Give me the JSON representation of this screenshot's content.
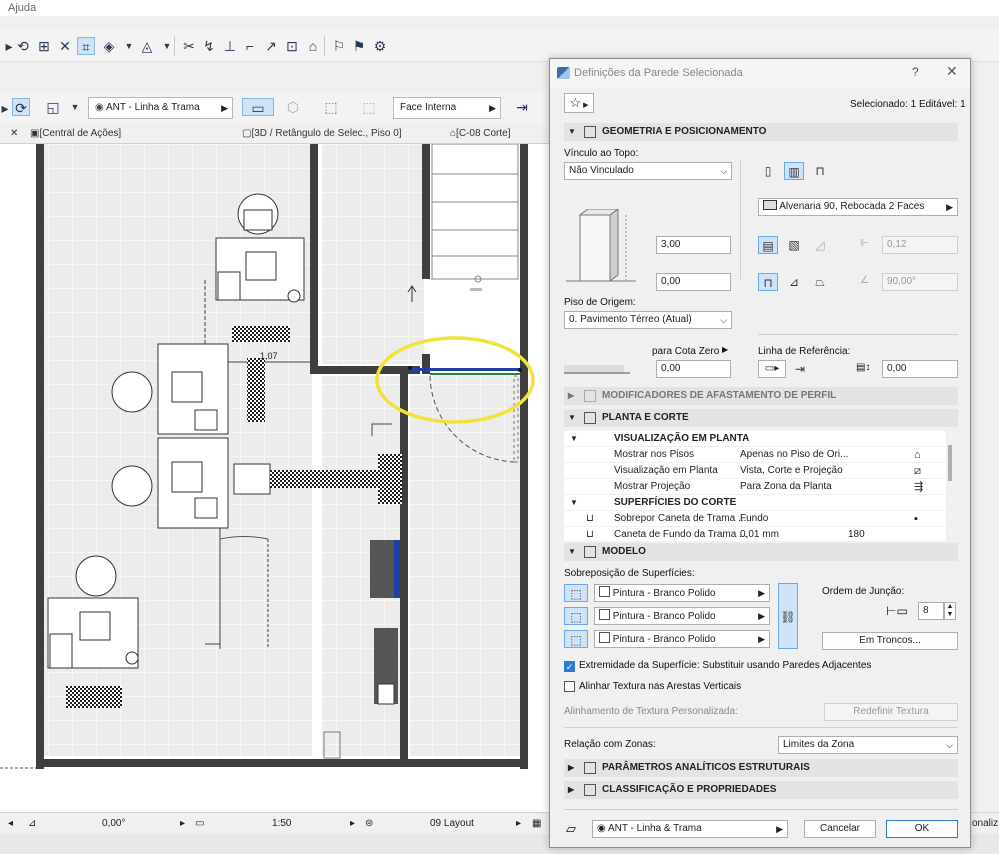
{
  "menu": {
    "help": "Ajuda"
  },
  "toolbar2": {
    "layer": "ANT - Linha & Trama",
    "surface": "Face Interna"
  },
  "tabs": [
    "[Central de Ações]",
    "[3D / Retângulo de Selec., Piso 0]",
    "[C-08 Corte]"
  ],
  "plan": {
    "dimension": "1,07"
  },
  "statusbar": {
    "angle": "0,00°",
    "scale": "1:50",
    "layout": "09 Layout",
    "edge_text": "onaliz"
  },
  "dialog": {
    "title": "Definições da Parede Selecionada",
    "help": "?",
    "close": "✕",
    "selected": "Selecionado: 1 Editável: 1",
    "sections": {
      "geometry": "GEOMETRIA E POSICIONAMENTO",
      "profile": "MODIFICADORES DE AFASTAMENTO DE PERFIL",
      "plan_section": "PLANTA E CORTE",
      "model": "MODELO",
      "structural": "PARÂMETROS ANALÍTICOS ESTRUTURAIS",
      "classification": "CLASSIFICAÇÃO E PROPRIEDADES"
    },
    "geometry": {
      "top_link_label": "Vínculo ao Topo:",
      "top_link_value": "Não Vinculado",
      "composite": "Alvenaria 90, Rebocada 2 Faces",
      "height": "3,00",
      "thickness": "0,12",
      "offset": "0,00",
      "angle": "90,00°",
      "home_story_label": "Piso de Origem:",
      "home_story_value": "0. Pavimento Térreo (Atual)",
      "to_project_zero": "para Cota Zero",
      "base_offset": "0,00",
      "ref_line_label": "Linha de Referência:",
      "ref_line_offset": "0,00"
    },
    "plan_tree": {
      "header1": "VISUALIZAÇÃO EM PLANTA",
      "rows": [
        {
          "name": "Mostrar nos Pisos",
          "value": "Apenas no Piso de Ori..."
        },
        {
          "name": "Visualização em Planta",
          "value": "Vista, Corte e Projeção"
        },
        {
          "name": "Mostrar Projeção",
          "value": "Para Zona da Planta"
        }
      ],
      "header2": "SUPERFÍCIES DO CORTE",
      "rows2": [
        {
          "name": "Sobrepor Caneta de Trama ...",
          "value": "Fundo"
        },
        {
          "name": "Caneta de Fundo da Trama ...",
          "value": "0,01 mm",
          "extra": "180"
        }
      ]
    },
    "model": {
      "override_label": "Sobreposição de Superfícies:",
      "surfaces": [
        "Pintura - Branco Polido",
        "Pintura - Branco Polido",
        "Pintura - Branco Polido"
      ],
      "junction_label": "Ordem de Junção:",
      "junction_value": "8",
      "log_button": "Em Troncos...",
      "extremity_check": "Extremidade da Superfície: Substituir usando Paredes Adjacentes",
      "align_texture": "Alinhar Textura nas Arestas Verticais",
      "custom_texture": "Alinhamento de Textura Personalizada:",
      "reset_texture": "Redefinir Textura"
    },
    "zones": {
      "label": "Relação com Zonas:",
      "value": "Limites da Zona"
    },
    "footer": {
      "layer": "ANT - Linha & Trama",
      "cancel": "Cancelar",
      "ok": "OK"
    }
  },
  "colors": {
    "accent": "#2e7ad1",
    "highlight": "#f2e23a",
    "selected_wall_blue": "#1e3fa8",
    "selected_wall_green": "#1f8a2a"
  }
}
